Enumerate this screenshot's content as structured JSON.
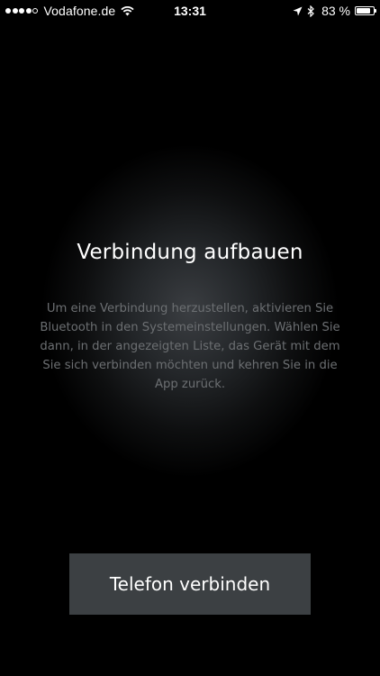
{
  "status_bar": {
    "signal_bars_filled": 4,
    "signal_bars_total": 5,
    "carrier": "Vodafone.de",
    "time": "13:31",
    "battery_percent_label": "83 %",
    "battery_level": 0.83,
    "icons": [
      "wifi-icon",
      "location-arrow-icon",
      "bluetooth-icon",
      "battery-icon"
    ]
  },
  "main": {
    "title": "Verbindung aufbauen",
    "description": "Um eine Verbindung herzustellen, aktivieren Sie Bluetooth in den Systemeinstellungen. Wählen Sie dann, in der angezeigten Liste, das Gerät mit dem Sie sich verbinden möchten und kehren Sie in die App zurück.",
    "connect_button_label": "Telefon verbinden"
  },
  "colors": {
    "background": "#000000",
    "glow": "#3b3e42",
    "button_background": "#3c4043",
    "description_text": "#6c6f72",
    "text": "#ffffff"
  }
}
